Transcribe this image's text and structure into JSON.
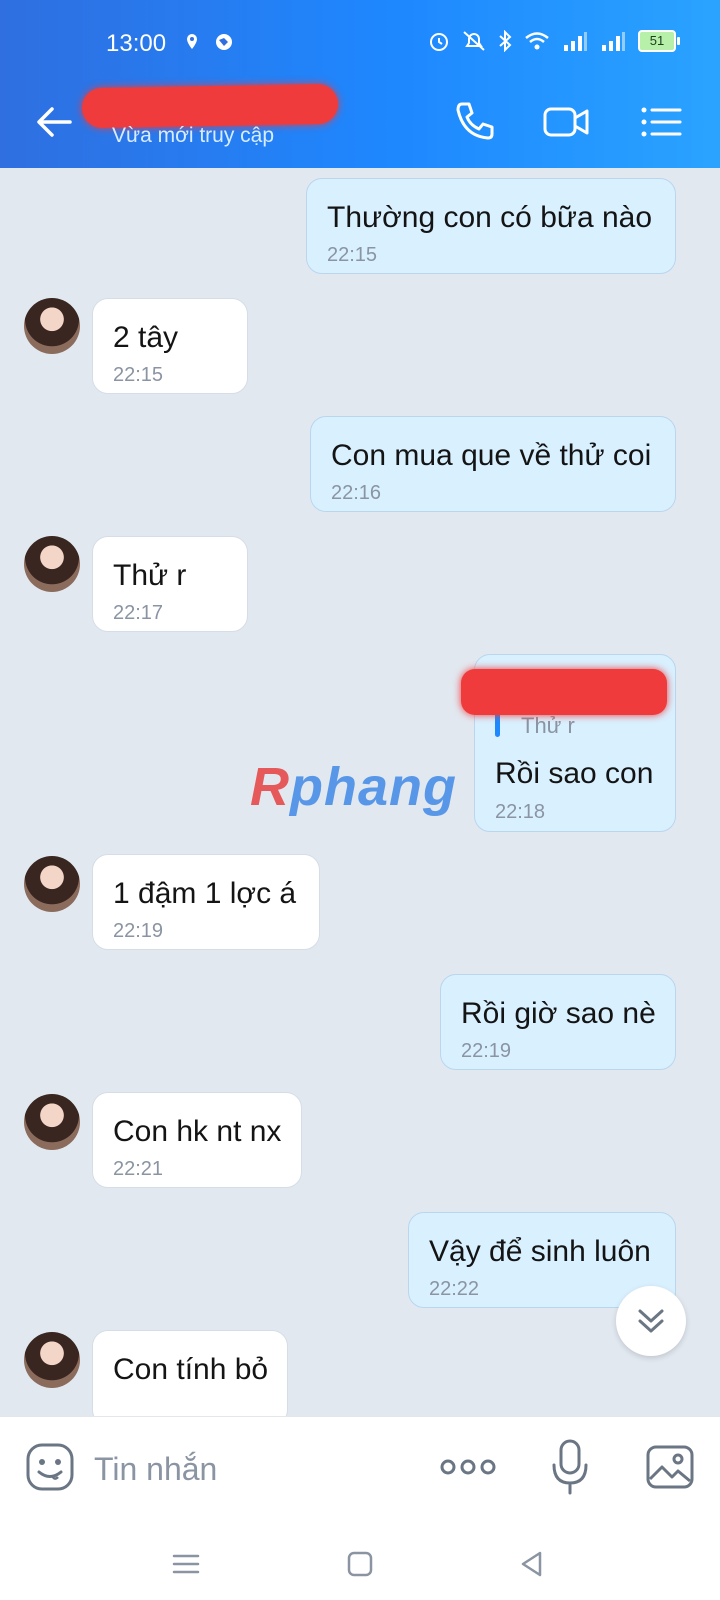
{
  "status_bar": {
    "time": "13:00",
    "battery": "51"
  },
  "header": {
    "subtitle": "Vừa mới truy cập"
  },
  "messages": [
    {
      "text": "Thường con có bữa nào",
      "time": "22:15"
    },
    {
      "text": "2 tây",
      "time": "22:15"
    },
    {
      "text": "Con mua que về thử coi",
      "time": "22:16"
    },
    {
      "text": "Thử r",
      "time": "22:17"
    },
    {
      "text": "Rồi sao con",
      "time": "22:18",
      "reply_quote": "Thử r"
    },
    {
      "text": "1 đậm 1 lợc á",
      "time": "22:19"
    },
    {
      "text": "Rồi giờ sao nè",
      "time": "22:19"
    },
    {
      "text": "Con hk nt nx",
      "time": "22:21"
    },
    {
      "text": "Vậy để sinh luôn",
      "time": "22:22"
    },
    {
      "text": "Con tính bỏ",
      "time": ""
    }
  ],
  "watermark": {
    "first": "R",
    "rest": "phang"
  },
  "input": {
    "placeholder": "Tin nhắn"
  },
  "colors": {
    "header": "#1e88ff",
    "outgoing": "#d9f0ff",
    "incoming": "#ffffff",
    "background": "#e2e8f0"
  }
}
